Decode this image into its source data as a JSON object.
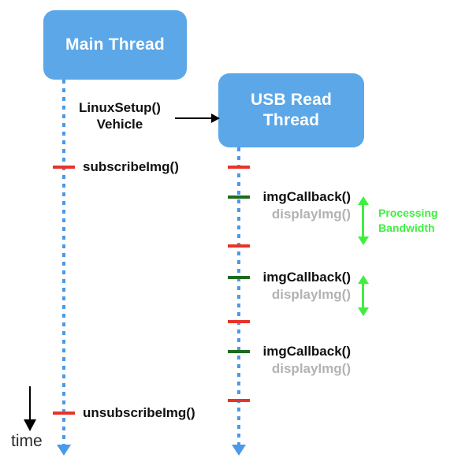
{
  "diagram": {
    "title_present": false,
    "colors": {
      "thread_box": "#5ba7e8",
      "lifeline": "#4a9ae8",
      "tick_red": "#e8332a",
      "tick_green": "#1d6b1d",
      "bandwidth_green": "#3ef03e",
      "muted_text": "#b3b3b3",
      "primary_text": "#111111"
    },
    "threads": [
      {
        "id": "main",
        "label": "Main Thread"
      },
      {
        "id": "usb",
        "label": "USB Read\nThread"
      }
    ],
    "thread_labels": {
      "main": "Main Thread",
      "usb_line1": "USB Read",
      "usb_line2": "Thread"
    },
    "messages": {
      "setup_line1": "LinuxSetup()",
      "setup_line2": "Vehicle",
      "subscribe": "subscribeImg()",
      "unsubscribe": "unsubscribeImg()"
    },
    "callbacks": [
      {
        "primary": "imgCallback()",
        "secondary": "displayImg()"
      },
      {
        "primary": "imgCallback()",
        "secondary": "displayImg()"
      },
      {
        "primary": "imgCallback()",
        "secondary": "displayImg()"
      }
    ],
    "annotations": {
      "bandwidth_line1": "Processing",
      "bandwidth_line2": "Bandwidth",
      "time_axis": "time"
    }
  }
}
